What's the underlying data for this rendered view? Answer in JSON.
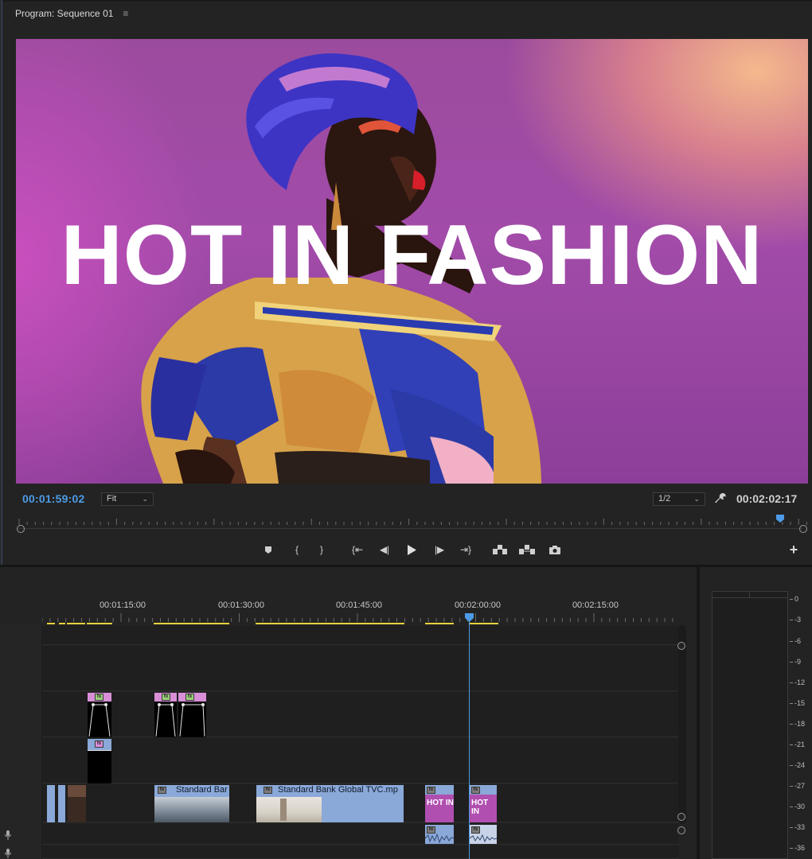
{
  "monitor": {
    "panel_title": "Program: Sequence 01",
    "menu_icon": "hamburger-menu-icon",
    "overlay_title": "HOT IN FASHION",
    "current_timecode": "00:01:59:02",
    "fit_value": "Fit",
    "resolution_value": "1/2",
    "duration_timecode": "00:02:02:17",
    "transport_buttons": [
      {
        "name": "add-marker-button",
        "icon": "marker-icon"
      },
      {
        "name": "mark-in-button",
        "icon": "{"
      },
      {
        "name": "mark-out-button",
        "icon": "}"
      },
      {
        "name": "go-to-in-button",
        "icon": "{←"
      },
      {
        "name": "step-back-button",
        "icon": "◀|"
      },
      {
        "name": "play-button",
        "icon": "▶"
      },
      {
        "name": "step-forward-button",
        "icon": "|▶"
      },
      {
        "name": "go-to-out-button",
        "icon": "→}"
      },
      {
        "name": "lift-button",
        "icon": "lift-icon"
      },
      {
        "name": "extract-button",
        "icon": "extract-icon"
      },
      {
        "name": "export-frame-button",
        "icon": "camera-icon"
      }
    ],
    "add_button": "+"
  },
  "timeline": {
    "ruler": [
      "00:01:15:00",
      "00:01:30:00",
      "00:01:45:00",
      "00:02:00:00",
      "00:02:15:00"
    ],
    "clips": {
      "v1_a_name": "Standard Bar",
      "v1_b_name": "Standard Bank Global TVC.mp",
      "v1_c_label": "HOT IN",
      "v1_d_label": "HOT IN"
    },
    "accent": "#4d9be6",
    "render_color": "#e6d23a",
    "clip_color": "#8aa8d8"
  },
  "meters": {
    "scale": [
      "0",
      "-3",
      "-6",
      "-9",
      "-12",
      "-15",
      "-18",
      "-21",
      "-24",
      "-27",
      "-30",
      "-33",
      "-36"
    ]
  }
}
